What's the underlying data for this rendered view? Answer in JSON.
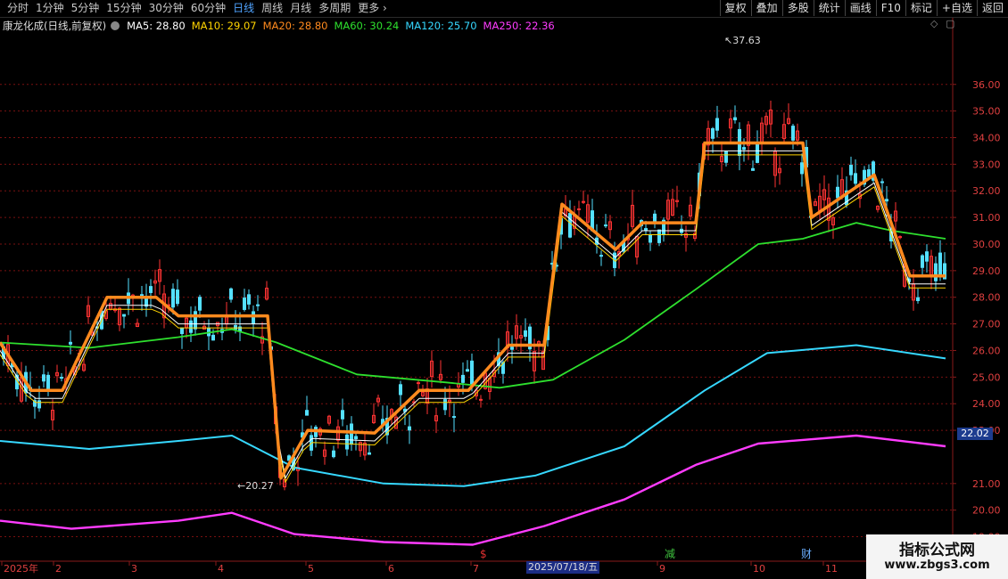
{
  "toolbar": {
    "tabs": [
      "分时",
      "1分钟",
      "5分钟",
      "15分钟",
      "30分钟",
      "60分钟",
      "日线",
      "周线",
      "月线",
      "多周期",
      "更多 ›"
    ],
    "active_tab": "日线",
    "tools": [
      "复权",
      "叠加",
      "多股",
      "统计",
      "画线",
      "F10",
      "标记",
      "+自选",
      "返回"
    ]
  },
  "legend": {
    "stock": "康龙化成",
    "period": "(日线,前复权)",
    "items": [
      {
        "label": "MA5: 28.80",
        "color": "#ffffff"
      },
      {
        "label": "MA10: 29.07",
        "color": "#ffd400"
      },
      {
        "label": "MA20: 28.80",
        "color": "#ff8a1e"
      },
      {
        "label": "MA60: 30.24",
        "color": "#2ee02e"
      },
      {
        "label": "MA120: 25.70",
        "color": "#36d8ff"
      },
      {
        "label": "MA250: 22.36",
        "color": "#ff3cff"
      }
    ]
  },
  "price_axis": {
    "ticks": [
      "36.00",
      "35.00",
      "34.00",
      "33.00",
      "32.00",
      "31.00",
      "30.00",
      "29.00",
      "28.00",
      "27.00",
      "26.00",
      "25.00",
      "24.00",
      "23.00",
      "21.00",
      "20.00",
      "19.00"
    ],
    "ymin": 18.55,
    "ymax": 37.9,
    "current": "22.02"
  },
  "annotations": {
    "high": "37.63",
    "low": "20.27"
  },
  "date_axis": {
    "labels": [
      "2025年",
      "2",
      "3",
      "4",
      "5",
      "6",
      "7",
      "8",
      "9",
      "10",
      "11"
    ],
    "cursor_date": "2025/07/18/五",
    "markers": [
      {
        "text": "$",
        "color": "#e03030"
      },
      {
        "text": "减",
        "color": "#3fc23f"
      },
      {
        "text": "财",
        "color": "#6aaeff"
      }
    ]
  },
  "colors": {
    "up": "#ff3333",
    "down": "#54e0ff",
    "grid": "#7a1010",
    "ma5": "#ffffff",
    "ma10": "#ffd400",
    "ma20": "#ff8a1e",
    "ma60": "#2ee02e",
    "ma120": "#36d8ff",
    "ma250": "#ff3cff"
  },
  "chart_data": {
    "type": "candlestick",
    "title": "康龙化成(日线,前复权)",
    "ylim": [
      18.55,
      37.9
    ],
    "x": [
      "Jan",
      "Feb",
      "Mar",
      "Apr",
      "May",
      "Jun",
      "Jul",
      "Aug",
      "Sep",
      "Oct",
      "Nov"
    ],
    "ma20_step": [
      26.3,
      24.5,
      25.8,
      28.0,
      27.3,
      27.3,
      21.2,
      23.0,
      22.9,
      24.5,
      23.8,
      26.2,
      31.5,
      29.8,
      30.8,
      31.3,
      33.8,
      33.8,
      31.0,
      32.6,
      31.0,
      28.8
    ],
    "ma60": [
      26.3,
      26.1,
      26.5,
      26.8,
      26.3,
      25.1,
      24.8,
      24.6,
      24.9,
      26.4,
      28.3,
      30.0,
      30.8,
      30.5,
      30.2
    ],
    "ma120": [
      22.6,
      22.3,
      22.6,
      22.8,
      21.6,
      21.0,
      20.9,
      21.3,
      22.4,
      23.6,
      25.2,
      25.9,
      26.2,
      25.7
    ],
    "ma250": [
      19.6,
      19.3,
      19.6,
      19.9,
      19.1,
      18.8,
      18.7,
      19.4,
      20.4,
      21.7,
      22.5,
      22.8,
      22.4
    ],
    "high": 37.63,
    "low": 20.27
  },
  "watermark": {
    "line1": "指标公式网",
    "line2": "www.zbgs3.com"
  }
}
